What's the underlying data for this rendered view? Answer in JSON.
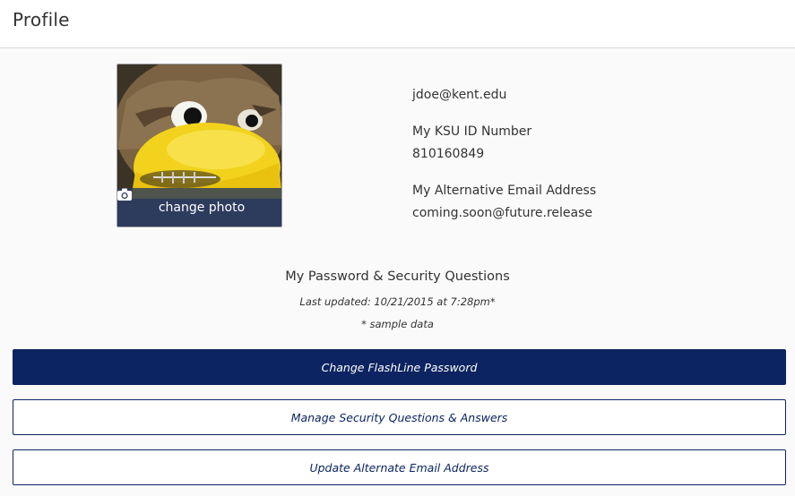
{
  "header": {
    "title": "Profile"
  },
  "photo": {
    "change_label": "change photo",
    "icon": "camera-icon"
  },
  "info": {
    "email": "jdoe@kent.edu",
    "ksu_id_label": "My KSU ID Number",
    "ksu_id_value": "810160849",
    "alt_email_label": "My Alternative Email Address",
    "alt_email_value": "coming.soon@future.release"
  },
  "security": {
    "title": "My Password & Security Questions",
    "last_updated": "Last updated: 10/21/2015 at 7:28pm*",
    "note": "* sample data"
  },
  "buttons": {
    "change_password": "Change FlashLine Password",
    "manage_security": "Manage Security Questions & Answers",
    "update_email": "Update Alternate Email Address"
  },
  "colors": {
    "primary": "#0c2461",
    "overlay": "#2d3c5a"
  }
}
